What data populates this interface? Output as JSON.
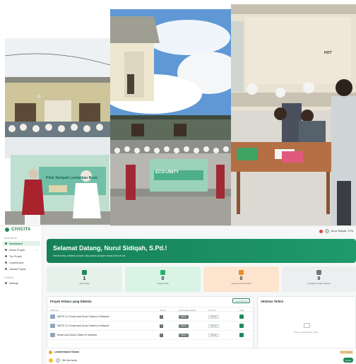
{
  "photos": {
    "ceremony_banner_text": "ECO-UNITY",
    "ceremony_banner_sub": "Pilah Sampah Lestarikan Bumi",
    "classroom_sign": "HOT"
  },
  "app": {
    "brand": "CIVICITA",
    "sidebar": {
      "section_main": "Main Menu",
      "section_other": "Lainnya",
      "items": [
        {
          "label": "Dashboard",
          "icon": "grid-icon"
        },
        {
          "label": "Kelola Proyek",
          "icon": "folder-icon"
        },
        {
          "label": "Tim Proyek",
          "icon": "users-icon"
        },
        {
          "label": "Leaderboard",
          "icon": "trophy-icon"
        },
        {
          "label": "Jadwal Proyek",
          "icon": "calendar-icon"
        },
        {
          "label": "Settings",
          "icon": "gear-icon"
        }
      ]
    },
    "topbar": {
      "user_name": "Nurul Sidiqah, S.Pd"
    },
    "banner": {
      "title": "Selamat Datang, Nurul Sidiqah, S.Pd.!",
      "subtitle": "Kelola kelas, fasilitasi proyek, dan pantau progres siswa Anda di sini."
    },
    "stats": [
      {
        "value": "1",
        "label": "Total Kelas",
        "bg": "#e7f1ec",
        "icon_color": "#1f8a5a",
        "icon": "class-icon"
      },
      {
        "value": "0",
        "label": "Proyek Aktif",
        "bg": "#d9f3e4",
        "icon_color": "#22b26b",
        "icon": "play-icon"
      },
      {
        "value": "0",
        "label": "Laporan Perlu Dinilai",
        "bg": "#fde4cf",
        "icon_color": "#f08a24",
        "icon": "document-icon"
      },
      {
        "value": "0",
        "label": "Penilaian Tugas Selesai",
        "bg": "#eceeef",
        "icon_color": "#6b7a74",
        "icon": "medal-icon"
      }
    ],
    "projects": {
      "title": "Proyek Terbaru yang Dikelola",
      "view_all": "Lihat Semua",
      "columns": [
        "Proyek",
        "Kelas",
        "Mata Pelajaran",
        "Status",
        "Aksi"
      ],
      "rows": [
        {
          "name": "SMTD 3.4 Smart and Good Citizen in Network",
          "kelas": "X",
          "mapel": "PPKn",
          "status": "Selesai"
        },
        {
          "name": "SMTD 3.4 Smart and Good Citizen in Network",
          "kelas": "X",
          "mapel": "PPKn",
          "status": "Selesai"
        },
        {
          "name": "Smart and Good Citizen in Network",
          "kelas": "X",
          "mapel": "PPKn",
          "status": "Selesai"
        }
      ]
    },
    "activity": {
      "title": "Aktivitas Terkini",
      "empty": "Belum ada aktivitas terkini."
    },
    "leaderboard": {
      "title": "Leaderboard Siswa",
      "badge": "Top 10 Siswa",
      "top": {
        "rank": "1",
        "name": "Siti Nur Aulia",
        "score": "0 poin"
      }
    }
  }
}
